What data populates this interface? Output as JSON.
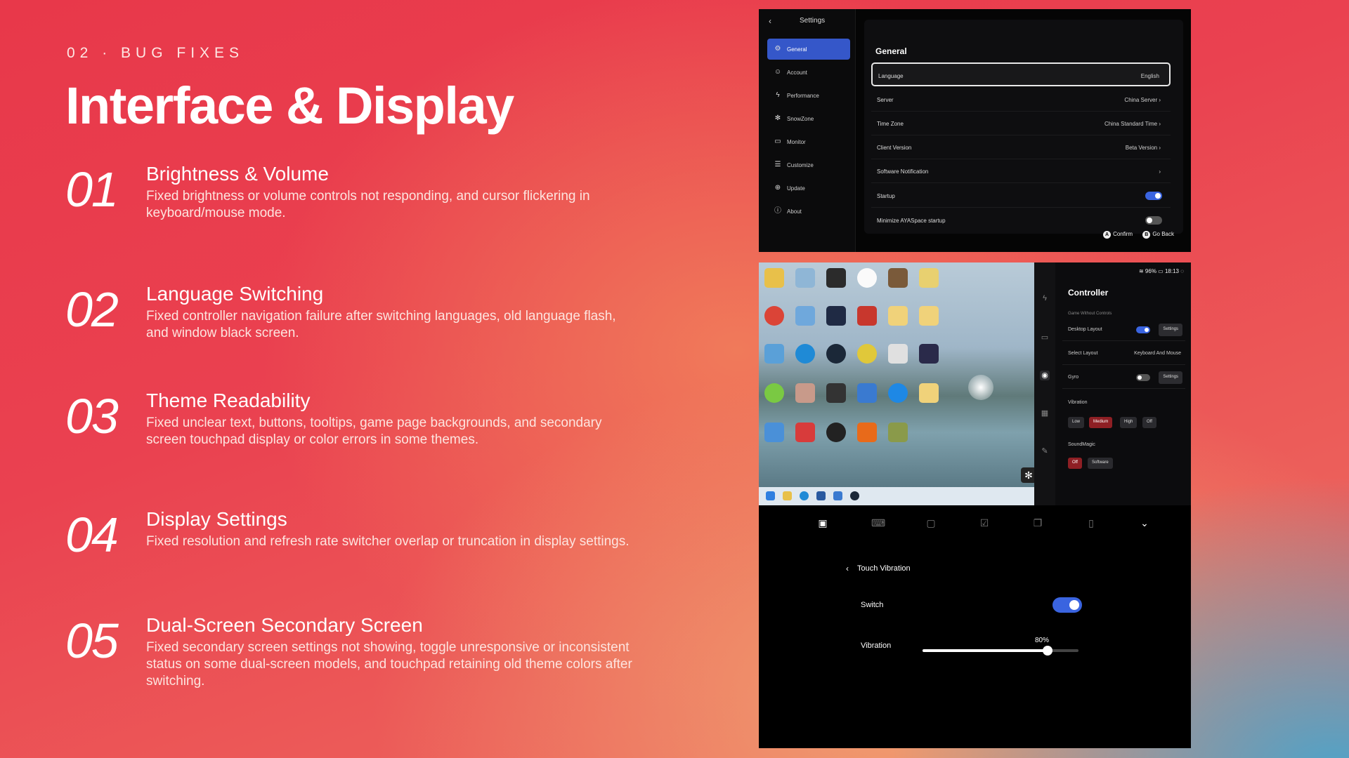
{
  "eyebrow": "02 · BUG FIXES",
  "headline": "Interface & Display",
  "items": [
    {
      "num": "01",
      "title": "Brightness & Volume",
      "desc": "Fixed brightness or volume controls not responding, and cursor flickering in keyboard/mouse mode."
    },
    {
      "num": "02",
      "title": "Language Switching",
      "desc": "Fixed controller navigation failure after switching languages, old language flash, and window black screen."
    },
    {
      "num": "03",
      "title": "Theme Readability",
      "desc": "Fixed unclear text, buttons, tooltips, game page backgrounds, and secondary screen touchpad display or color errors in some themes."
    },
    {
      "num": "04",
      "title": "Display Settings",
      "desc": "Fixed resolution and refresh rate switcher overlap or truncation in display settings."
    },
    {
      "num": "05",
      "title": "Dual-Screen Secondary Screen",
      "desc": "Fixed secondary screen settings not showing, toggle unresponsive or inconsistent status on some dual-screen models, and touchpad retaining old theme colors after switching."
    }
  ],
  "settings": {
    "title": "Settings",
    "sidebar": [
      {
        "label": "General",
        "icon": "gear-icon"
      },
      {
        "label": "Account",
        "icon": "user-icon"
      },
      {
        "label": "Performance",
        "icon": "lightning-icon"
      },
      {
        "label": "SnowZone",
        "icon": "snowflake-icon"
      },
      {
        "label": "Monitor",
        "icon": "monitor-icon"
      },
      {
        "label": "Customize",
        "icon": "sliders-icon"
      },
      {
        "label": "Update",
        "icon": "download-icon"
      },
      {
        "label": "About",
        "icon": "info-icon"
      }
    ],
    "heading": "General",
    "rows": [
      {
        "label": "Language",
        "value": "English"
      },
      {
        "label": "Server",
        "value": "China Server"
      },
      {
        "label": "Time Zone",
        "value": "China Standard Time"
      },
      {
        "label": "Client Version",
        "value": "Beta Version"
      },
      {
        "label": "Software Notification",
        "value": ""
      },
      {
        "label": "Startup",
        "value": ""
      },
      {
        "label": "Minimize AYASpace startup",
        "value": ""
      }
    ],
    "startup_on": true,
    "minimize_on": false,
    "hints": {
      "confirm": "Confirm",
      "back": "Go Back",
      "a": "A",
      "b": "B"
    }
  },
  "controller": {
    "status": {
      "battery": "96%",
      "time": "18:13"
    },
    "title": "Controller",
    "subtitle": "Game Without Controls",
    "desktop_layout": "Desktop Layout",
    "select_layout": "Select Layout",
    "layout_value": "Keyboard And Mouse",
    "gyro": "Gyro",
    "settings_btn": "Settings",
    "vibration": "Vibration",
    "vibration_levels": [
      "Low",
      "Medium",
      "High",
      "Off"
    ],
    "soundmagic": "SoundMagic",
    "soundmagic_options": [
      "Off",
      "Software"
    ]
  },
  "touch": {
    "title": "Touch Vibration",
    "switch_label": "Switch",
    "vibration_label": "Vibration",
    "vibration_value": "80%",
    "vibration_level": 0.8
  }
}
